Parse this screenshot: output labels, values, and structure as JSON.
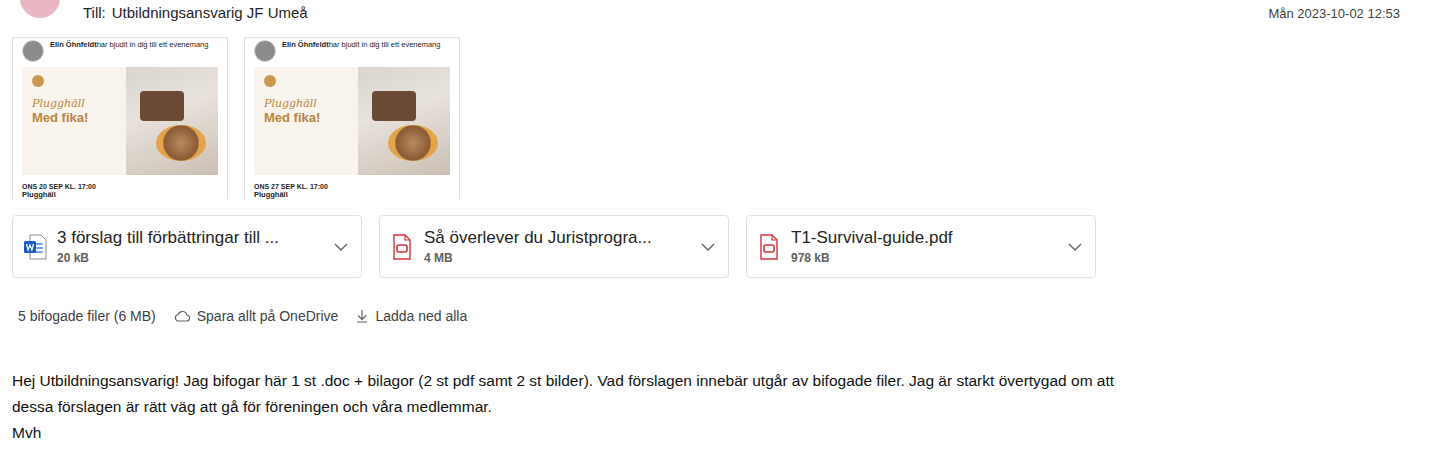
{
  "header": {
    "to_label": "Till:",
    "recipient": "Utbildningsansvarig JF Umeå",
    "date": "Mån 2023-10-02 12:53"
  },
  "image_attachments": [
    {
      "inviter": "Elin Öhnfeldt",
      "invite_text": "har bjudit in dig till ett evenemang",
      "title_script": "Plugghäll",
      "title_bold": "Med fika!",
      "date": "ONS 20 SEP KL. 17:00",
      "event_name": "Plugghäll"
    },
    {
      "inviter": "Elin Öhnfeldt",
      "invite_text": "har bjudit in dig till ett evenemang",
      "title_script": "Plugghäll",
      "title_bold": "Med fika!",
      "date": "ONS 27 SEP KL. 17:00",
      "event_name": "Plugghäll"
    }
  ],
  "file_attachments": [
    {
      "name": "3 förslag till förbättringar till ...",
      "size": "20 kB",
      "kind": "word"
    },
    {
      "name": "Så överlever du Juristprogra...",
      "size": "4 MB",
      "kind": "pdf"
    },
    {
      "name": "T1-Survival-guide.pdf",
      "size": "978 kB",
      "kind": "pdf"
    }
  ],
  "attachment_summary": {
    "count_text": "5 bifogade filer (6 MB)",
    "save_label": "Spara allt på OneDrive",
    "download_label": "Ladda ned alla"
  },
  "body": {
    "lines": [
      "Hej Utbildningsansvarig! Jag bifogar här 1 st .doc + bilagor (2 st pdf samt 2 st bilder). Vad förslagen innebär utgår av bifogade filer. Jag är starkt övertygad om att",
      "dessa förslagen är rätt väg att gå för föreningen och våra medlemmar.",
      "Mvh"
    ]
  }
}
